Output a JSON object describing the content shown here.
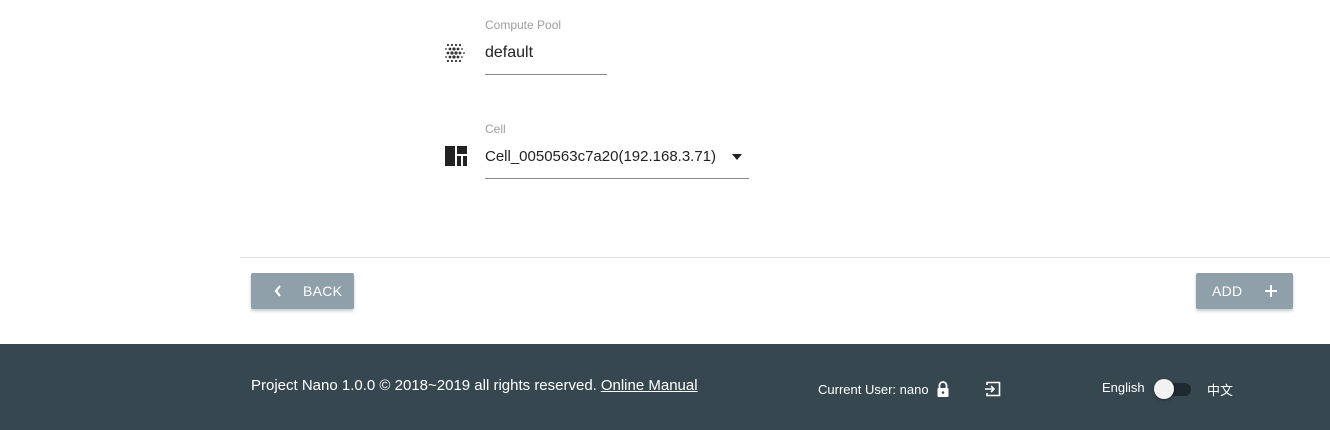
{
  "form": {
    "compute_pool": {
      "label": "Compute Pool",
      "value": "default",
      "icon": "grain-icon"
    },
    "cell": {
      "label": "Cell",
      "value": "Cell_0050563c7a20(192.168.3.71)",
      "icon": "dashboard-icon"
    }
  },
  "actions": {
    "back_label": "BACK",
    "add_label": "ADD"
  },
  "footer": {
    "copyright": "Project Nano 1.0.0 © 2018~2019 all rights reserved.",
    "manual_link": "Online Manual",
    "current_user": "Current User: nano",
    "language_left": "English",
    "language_right": "中文"
  },
  "colors": {
    "button": "#8fa0aa",
    "footer": "#37474f"
  }
}
